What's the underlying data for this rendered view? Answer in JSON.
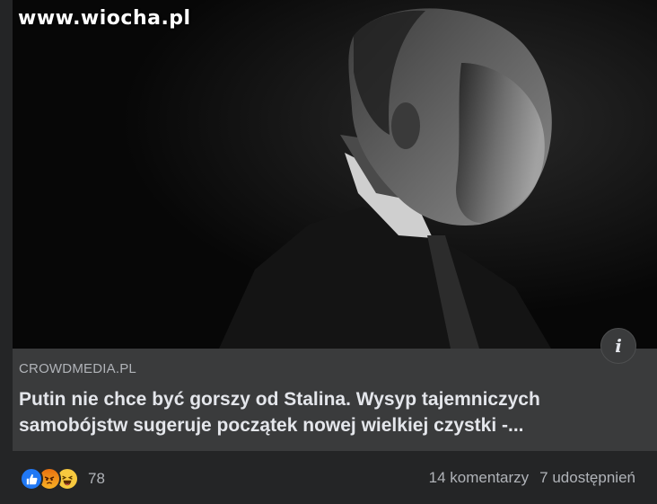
{
  "watermark": {
    "text": "www.wiocha.pl"
  },
  "post": {
    "image_icon": "portrait-photo",
    "info_icon": "info-icon",
    "link": {
      "source": "CROWDMEDIA.PL",
      "headline": "Putin nie chce być gorszy od Stalina. Wysyp tajemniczych samobójstw sugeruje początek nowej wielkiej czystki -..."
    }
  },
  "footer": {
    "reactions": {
      "icons": [
        "like-icon",
        "angry-icon",
        "haha-icon"
      ],
      "count": "78"
    },
    "comments": "14 komentarzy",
    "shares": "7 udostępnień"
  },
  "colors": {
    "background": "#242526",
    "link_box": "#3a3b3c",
    "like_blue": "#2078f4",
    "muted_text": "#b0b3b8",
    "primary_text": "#e4e6eb"
  }
}
